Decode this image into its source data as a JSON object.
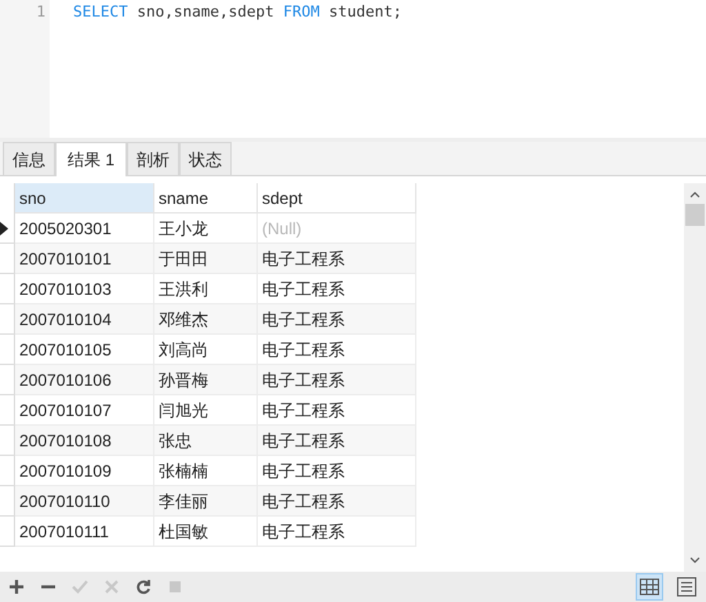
{
  "editor": {
    "lines": [
      {
        "number": "1",
        "tokens": [
          {
            "text": "SELECT",
            "kind": "keyword"
          },
          {
            "text": " sno,sname,sdept ",
            "kind": "plain"
          },
          {
            "text": "FROM",
            "kind": "keyword"
          },
          {
            "text": " student;",
            "kind": "plain"
          }
        ]
      }
    ]
  },
  "tabs": [
    {
      "label": "信息",
      "selected": false
    },
    {
      "label": "结果 1",
      "selected": true
    },
    {
      "label": "剖析",
      "selected": false
    },
    {
      "label": "状态",
      "selected": false
    }
  ],
  "table": {
    "columns": [
      {
        "label": "sno",
        "selected": true
      },
      {
        "label": "sname",
        "selected": false
      },
      {
        "label": "sdept",
        "selected": false
      }
    ],
    "rows": [
      {
        "current": true,
        "cells": [
          {
            "text": "2005020301",
            "null": false
          },
          {
            "text": "王小龙",
            "null": false
          },
          {
            "text": "(Null)",
            "null": true
          }
        ]
      },
      {
        "current": false,
        "cells": [
          {
            "text": "2007010101",
            "null": false
          },
          {
            "text": "于田田",
            "null": false
          },
          {
            "text": "电子工程系",
            "null": false
          }
        ]
      },
      {
        "current": false,
        "cells": [
          {
            "text": "2007010103",
            "null": false
          },
          {
            "text": "王洪利",
            "null": false
          },
          {
            "text": "电子工程系",
            "null": false
          }
        ]
      },
      {
        "current": false,
        "cells": [
          {
            "text": "2007010104",
            "null": false
          },
          {
            "text": "邓维杰",
            "null": false
          },
          {
            "text": "电子工程系",
            "null": false
          }
        ]
      },
      {
        "current": false,
        "cells": [
          {
            "text": "2007010105",
            "null": false
          },
          {
            "text": "刘高尚",
            "null": false
          },
          {
            "text": "电子工程系",
            "null": false
          }
        ]
      },
      {
        "current": false,
        "cells": [
          {
            "text": "2007010106",
            "null": false
          },
          {
            "text": "孙晋梅",
            "null": false
          },
          {
            "text": "电子工程系",
            "null": false
          }
        ]
      },
      {
        "current": false,
        "cells": [
          {
            "text": "2007010107",
            "null": false
          },
          {
            "text": "闫旭光",
            "null": false
          },
          {
            "text": "电子工程系",
            "null": false
          }
        ]
      },
      {
        "current": false,
        "cells": [
          {
            "text": "2007010108",
            "null": false
          },
          {
            "text": "张忠",
            "null": false
          },
          {
            "text": "电子工程系",
            "null": false
          }
        ]
      },
      {
        "current": false,
        "cells": [
          {
            "text": "2007010109",
            "null": false
          },
          {
            "text": "张楠楠",
            "null": false
          },
          {
            "text": "电子工程系",
            "null": false
          }
        ]
      },
      {
        "current": false,
        "cells": [
          {
            "text": "2007010110",
            "null": false
          },
          {
            "text": "李佳丽",
            "null": false
          },
          {
            "text": "电子工程系",
            "null": false
          }
        ]
      },
      {
        "current": false,
        "cells": [
          {
            "text": "2007010111",
            "null": false
          },
          {
            "text": "杜国敏",
            "null": false
          },
          {
            "text": "电子工程系",
            "null": false
          }
        ]
      }
    ]
  },
  "toolbar": {
    "actions": [
      {
        "kind": "add",
        "disabled": false
      },
      {
        "kind": "remove",
        "disabled": false
      },
      {
        "kind": "apply",
        "disabled": true
      },
      {
        "kind": "discard",
        "disabled": true
      },
      {
        "kind": "refresh",
        "disabled": false
      },
      {
        "kind": "stop",
        "disabled": true
      }
    ],
    "views": [
      {
        "kind": "grid",
        "selected": true
      },
      {
        "kind": "form",
        "selected": false
      }
    ]
  }
}
